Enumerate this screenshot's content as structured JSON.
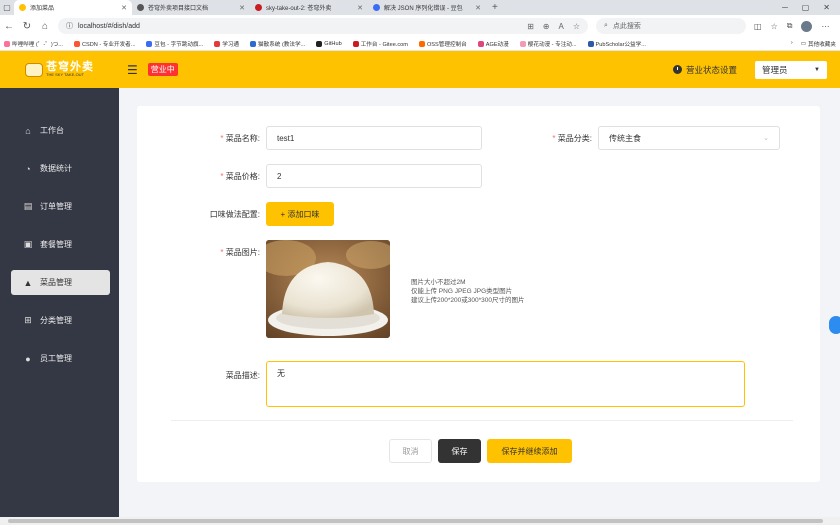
{
  "browser": {
    "tabs": [
      {
        "title": "添加菜品",
        "color": "#ffc200",
        "active": true
      },
      {
        "title": "苍穹外卖项目接口文档",
        "color": "#555555",
        "active": false
      },
      {
        "title": "sky-take-out-2: 苍穹外卖",
        "color": "#c71d23",
        "active": false
      },
      {
        "title": "解决 JSON 序列化错误 - 豆包",
        "color": "#3a6cf4",
        "active": false
      }
    ],
    "url": "localhost/#/dish/add",
    "search_placeholder": "点此搜索",
    "bookmarks": [
      "哔哩哔哩 (゜-゜)つ...",
      "CSDN - 专业开发者...",
      "豆包 - 字节跳动旗...",
      "学习通",
      "猫散系统 (教法学...",
      "GitHub",
      "工作台 - Gitee.com",
      "OSS管理控制台",
      "AGE动漫",
      "樱花动漫 - 专注动...",
      "PubScholar公益学..."
    ],
    "other_bookmarks": "其他收藏夹"
  },
  "header": {
    "logo_title": "苍穹外卖",
    "logo_sub": "THE SKY TAKE-OUT",
    "status": "营业中",
    "shop_settings": "营业状态设置",
    "user": "管理员"
  },
  "sidebar": {
    "items": [
      {
        "label": "工作台",
        "icon": "home-icon",
        "active": false
      },
      {
        "label": "数据统计",
        "icon": "chart-icon",
        "active": false
      },
      {
        "label": "订单管理",
        "icon": "order-icon",
        "active": false
      },
      {
        "label": "套餐管理",
        "icon": "combo-icon",
        "active": false
      },
      {
        "label": "菜品管理",
        "icon": "dish-icon",
        "active": true
      },
      {
        "label": "分类管理",
        "icon": "category-icon",
        "active": false
      },
      {
        "label": "员工管理",
        "icon": "employee-icon",
        "active": false
      }
    ]
  },
  "form": {
    "name_label": "菜品名称:",
    "name_value": "test1",
    "category_label": "菜品分类:",
    "category_value": "传统主食",
    "price_label": "菜品价格:",
    "price_value": "2",
    "flavor_label": "口味做法配置:",
    "add_flavor": "+ 添加口味",
    "image_label": "菜品图片:",
    "image_tips": [
      "图片大小不超过2M",
      "仅能上传 PNG JPEG JPG类型图片",
      "建议上传200*200或300*300尺寸的图片"
    ],
    "desc_label": "菜品描述:",
    "desc_value": "无",
    "required_mark": "*"
  },
  "actions": {
    "cancel": "取消",
    "save": "保存",
    "save_continue": "保存并继续添加"
  },
  "colors": {
    "brand": "#ffc200",
    "sidebar": "#343744",
    "status": "#fd3333"
  }
}
